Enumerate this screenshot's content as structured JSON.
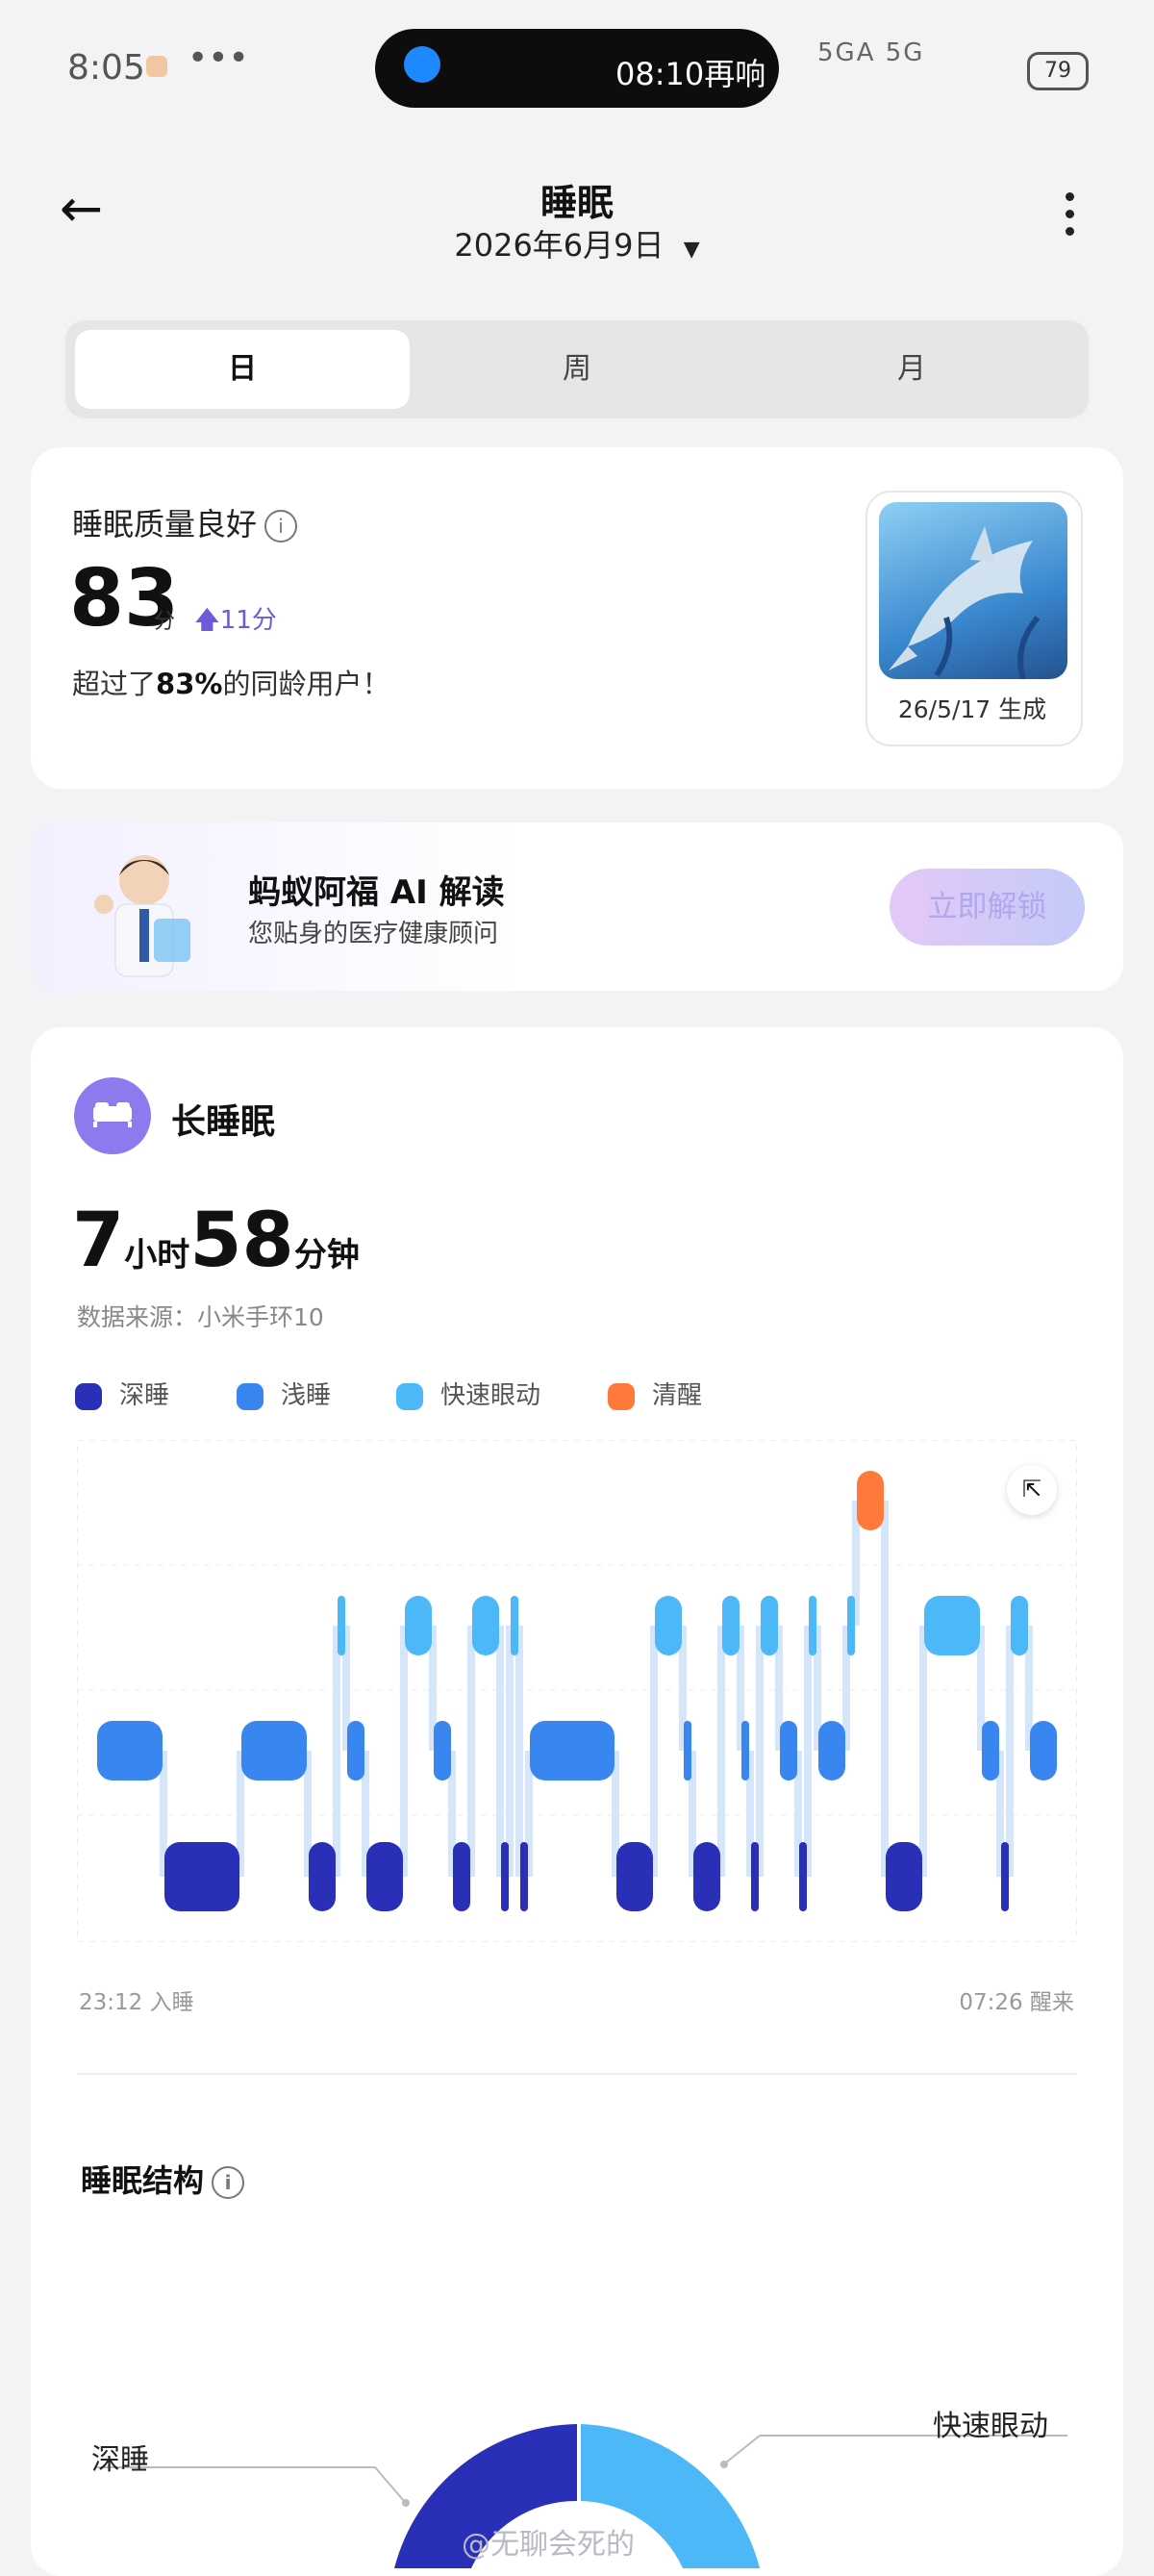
{
  "status_bar": {
    "time": "8:05",
    "overflow": "•••",
    "alarm_text": "08:10再响",
    "signal_text": "5GA 5G",
    "battery": "79"
  },
  "header": {
    "title": "睡眠",
    "date": "2026年6月9日"
  },
  "tabs": [
    {
      "label": "日",
      "active": true
    },
    {
      "label": "周",
      "active": false
    },
    {
      "label": "月",
      "active": false
    }
  ],
  "quality": {
    "title": "睡眠质量良好",
    "score": "83",
    "unit": "分",
    "delta": "11分",
    "exceed_prefix": "超过了",
    "exceed_value": "83%",
    "exceed_suffix": "的同龄用户！",
    "thumb_caption": "26/5/17 生成"
  },
  "ai": {
    "title": "蚂蚁阿福 AI 解读",
    "subtitle": "您贴身的医疗健康顾问",
    "button": "立即解锁"
  },
  "sleep": {
    "label": "长睡眠",
    "hours": "7",
    "hours_unit": "小时",
    "minutes": "58",
    "minutes_unit": "分钟",
    "source": "数据来源：小米手环10",
    "start": "23:12 入睡",
    "end": "07:26 醒来",
    "structure_title": "睡眠结构",
    "donut_label_deep": "深睡",
    "donut_label_rem": "快速眼动"
  },
  "chart_data": {
    "type": "hypnogram",
    "stages": [
      "深睡",
      "浅睡",
      "快速眼动",
      "清醒"
    ],
    "colors": {
      "深睡": "#2a2fb8",
      "浅睡": "#3a86f0",
      "快速眼动": "#4cb8f7",
      "清醒": "#ff7a3a"
    },
    "x_start": "23:12",
    "x_end": "07:26",
    "segments": [
      {
        "stage": "浅睡",
        "start": 0.0,
        "end": 0.07
      },
      {
        "stage": "深睡",
        "start": 0.07,
        "end": 0.15
      },
      {
        "stage": "浅睡",
        "start": 0.15,
        "end": 0.22
      },
      {
        "stage": "深睡",
        "start": 0.22,
        "end": 0.25
      },
      {
        "stage": "快速眼动",
        "start": 0.25,
        "end": 0.26
      },
      {
        "stage": "浅睡",
        "start": 0.26,
        "end": 0.28
      },
      {
        "stage": "深睡",
        "start": 0.28,
        "end": 0.32
      },
      {
        "stage": "快速眼动",
        "start": 0.32,
        "end": 0.35
      },
      {
        "stage": "浅睡",
        "start": 0.35,
        "end": 0.37
      },
      {
        "stage": "深睡",
        "start": 0.37,
        "end": 0.39
      },
      {
        "stage": "快速眼动",
        "start": 0.39,
        "end": 0.42
      },
      {
        "stage": "深睡",
        "start": 0.42,
        "end": 0.43
      },
      {
        "stage": "快速眼动",
        "start": 0.43,
        "end": 0.44
      },
      {
        "stage": "深睡",
        "start": 0.44,
        "end": 0.45
      },
      {
        "stage": "浅睡",
        "start": 0.45,
        "end": 0.54
      },
      {
        "stage": "深睡",
        "start": 0.54,
        "end": 0.58
      },
      {
        "stage": "快速眼动",
        "start": 0.58,
        "end": 0.61
      },
      {
        "stage": "浅睡",
        "start": 0.61,
        "end": 0.62
      },
      {
        "stage": "深睡",
        "start": 0.62,
        "end": 0.65
      },
      {
        "stage": "快速眼动",
        "start": 0.65,
        "end": 0.67
      },
      {
        "stage": "浅睡",
        "start": 0.67,
        "end": 0.68
      },
      {
        "stage": "深睡",
        "start": 0.68,
        "end": 0.69
      },
      {
        "stage": "快速眼动",
        "start": 0.69,
        "end": 0.71
      },
      {
        "stage": "浅睡",
        "start": 0.71,
        "end": 0.73
      },
      {
        "stage": "深睡",
        "start": 0.73,
        "end": 0.74
      },
      {
        "stage": "快速眼动",
        "start": 0.74,
        "end": 0.75
      },
      {
        "stage": "浅睡",
        "start": 0.75,
        "end": 0.78
      },
      {
        "stage": "快速眼动",
        "start": 0.78,
        "end": 0.79
      },
      {
        "stage": "清醒",
        "start": 0.79,
        "end": 0.82
      },
      {
        "stage": "深睡",
        "start": 0.82,
        "end": 0.86
      },
      {
        "stage": "快速眼动",
        "start": 0.86,
        "end": 0.92
      },
      {
        "stage": "浅睡",
        "start": 0.92,
        "end": 0.94
      },
      {
        "stage": "深睡",
        "start": 0.94,
        "end": 0.95
      },
      {
        "stage": "快速眼动",
        "start": 0.95,
        "end": 0.97
      },
      {
        "stage": "浅睡",
        "start": 0.97,
        "end": 1.0
      }
    ]
  },
  "watermark": "@无聊会死的"
}
